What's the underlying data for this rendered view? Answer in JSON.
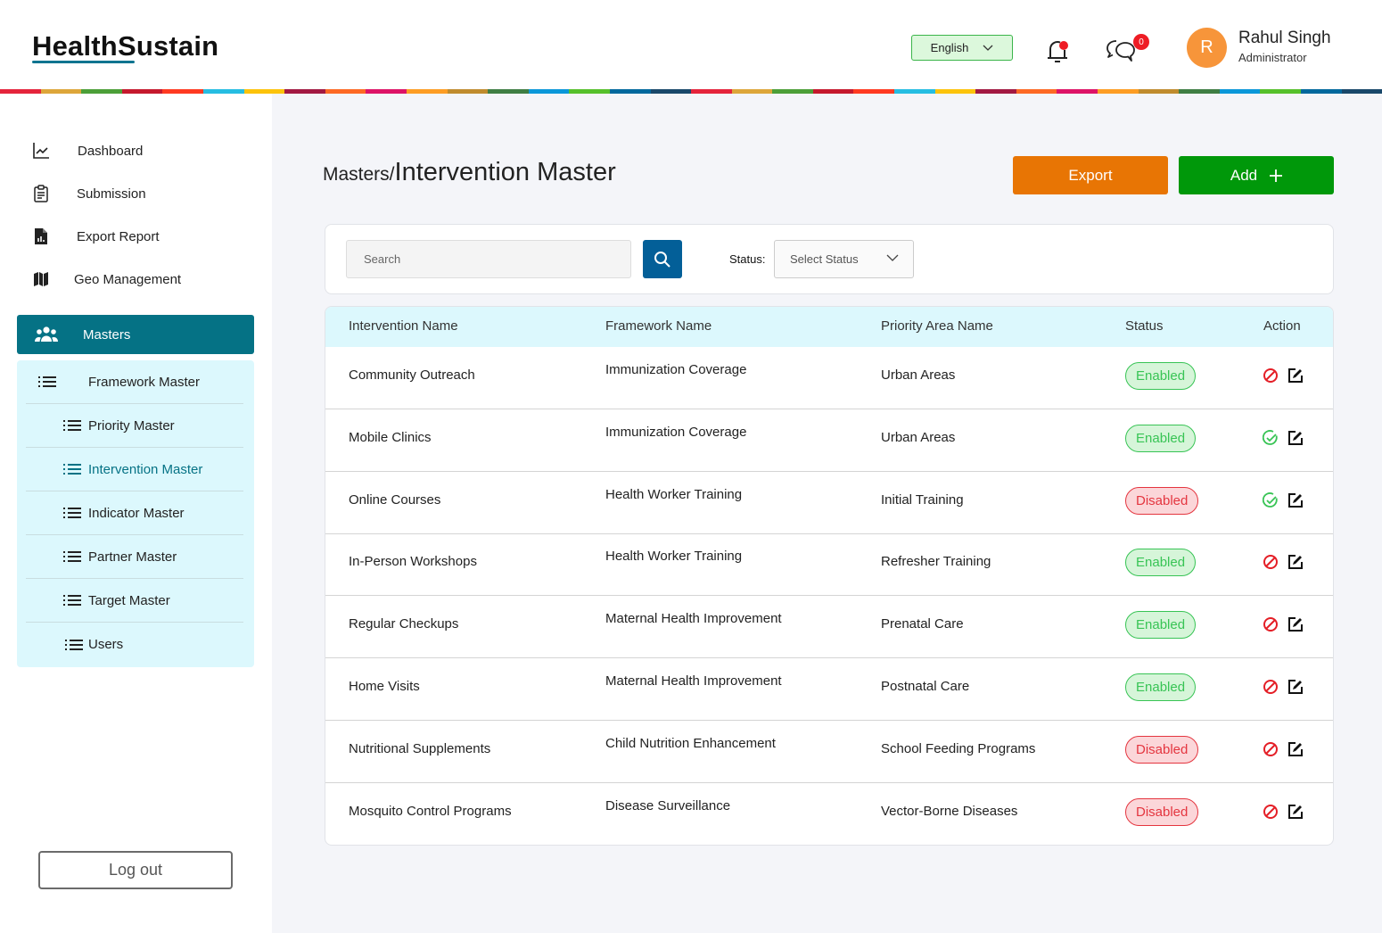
{
  "app": {
    "name": "HealthSustain"
  },
  "header": {
    "language": "English",
    "notifications_has_dot": true,
    "messages_count": "0",
    "user": {
      "initial": "R",
      "name": "Rahul Singh",
      "role": "Administrator"
    }
  },
  "colors": {
    "brand_teal": "#057285",
    "export": "#e87504",
    "add": "#00980a",
    "search_button": "#035f98",
    "enabled": "#38c455",
    "disabled": "#e4353f",
    "stripe": [
      "#e5243b",
      "#dda63a",
      "#4c9f38",
      "#c5192d",
      "#ff3a21",
      "#26bde2",
      "#fcc30b",
      "#a21942",
      "#fd6925",
      "#dd1367",
      "#fd9d24",
      "#bf8b2e",
      "#3f7e44",
      "#0a97d9",
      "#56c02b",
      "#00689d",
      "#19486a"
    ]
  },
  "sidebar": {
    "items": [
      {
        "label": "Dashboard",
        "icon": "chart-line-icon"
      },
      {
        "label": "Submission",
        "icon": "clipboard-icon"
      },
      {
        "label": "Export Report",
        "icon": "report-file-icon"
      },
      {
        "label": "Geo Management",
        "icon": "map-icon"
      }
    ],
    "masters": {
      "label": "Masters",
      "icon": "users-group-icon"
    },
    "submenu": [
      {
        "label": "Framework Master",
        "active": false
      },
      {
        "label": "Priority Master",
        "active": false
      },
      {
        "label": "Intervention Master",
        "active": true
      },
      {
        "label": "Indicator Master",
        "active": false
      },
      {
        "label": "Partner Master",
        "active": false
      },
      {
        "label": "Target Master",
        "active": false
      },
      {
        "label": "Users",
        "active": false
      }
    ],
    "logout": "Log out"
  },
  "main": {
    "breadcrumb": "Masters/",
    "title": "Intervention Master",
    "export_label": "Export",
    "add_label": "Add",
    "search": {
      "placeholder": "Search",
      "value": ""
    },
    "status_filter": {
      "label": "Status:",
      "selected": "Select Status"
    },
    "table": {
      "columns": [
        "Intervention Name",
        "Framework Name",
        "Priority Area Name",
        "Status",
        "Action"
      ],
      "rows": [
        {
          "intervention": "Community Outreach",
          "framework": "Immunization Coverage",
          "priority": "Urban Areas",
          "status": "Enabled",
          "toggle_action": "disable"
        },
        {
          "intervention": "Mobile Clinics",
          "framework": "Immunization Coverage",
          "priority": "Urban Areas",
          "status": "Enabled",
          "toggle_action": "enable"
        },
        {
          "intervention": "Online Courses",
          "framework": "Health Worker Training",
          "priority": "Initial Training",
          "status": "Disabled",
          "toggle_action": "enable"
        },
        {
          "intervention": "In-Person Workshops",
          "framework": "Health Worker Training",
          "priority": "Refresher Training",
          "status": "Enabled",
          "toggle_action": "disable"
        },
        {
          "intervention": "Regular Checkups",
          "framework": "Maternal Health Improvement",
          "priority": "Prenatal Care",
          "status": "Enabled",
          "toggle_action": "disable"
        },
        {
          "intervention": "Home Visits",
          "framework": "Maternal Health Improvement",
          "priority": "Postnatal Care",
          "status": "Enabled",
          "toggle_action": "disable"
        },
        {
          "intervention": "Nutritional Supplements",
          "framework": "Child Nutrition Enhancement",
          "priority": "School Feeding Programs",
          "status": "Disabled",
          "toggle_action": "disable"
        },
        {
          "intervention": "Mosquito Control Programs",
          "framework": "Disease Surveillance",
          "priority": "Vector-Borne Diseases",
          "status": "Disabled",
          "toggle_action": "disable"
        }
      ]
    }
  }
}
